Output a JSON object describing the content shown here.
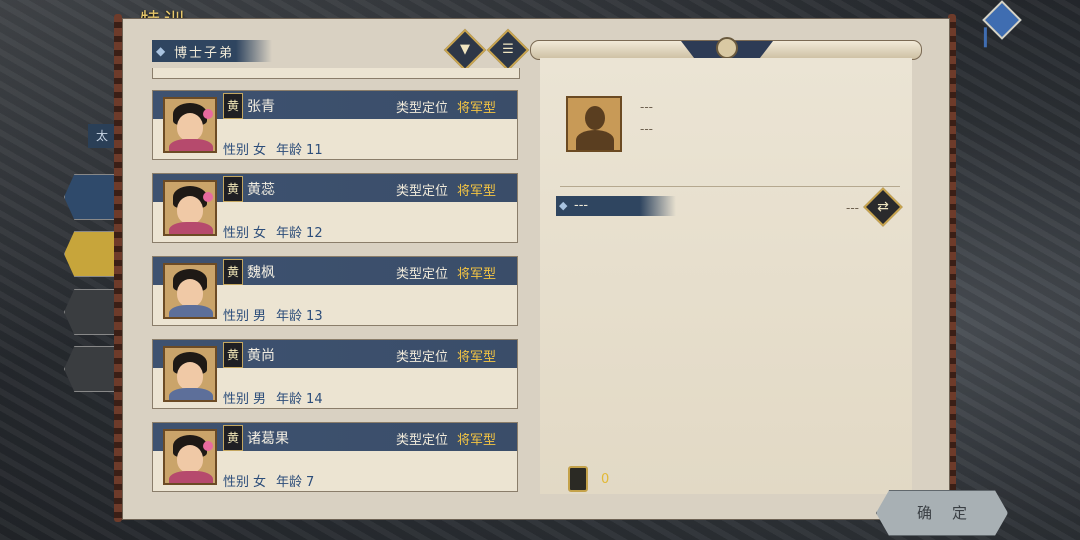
{
  "window": {
    "title": "特训",
    "side_label": "太"
  },
  "list": {
    "header": "博士子弟",
    "filter_icon": "filter-icon",
    "sort_icon": "list-icon",
    "type_label": "类型定位",
    "gender_label": "性别",
    "age_label": "年龄",
    "items": [
      {
        "badge": "黄",
        "name": "张青",
        "type": "将军型",
        "gender": "女",
        "age": "11",
        "sex": "female"
      },
      {
        "badge": "黄",
        "name": "黄蕊",
        "type": "将军型",
        "gender": "女",
        "age": "12",
        "sex": "female"
      },
      {
        "badge": "黄",
        "name": "魏枫",
        "type": "将军型",
        "gender": "男",
        "age": "13",
        "sex": "male"
      },
      {
        "badge": "黄",
        "name": "黄尚",
        "type": "将军型",
        "gender": "男",
        "age": "14",
        "sex": "male"
      },
      {
        "badge": "黄",
        "name": "诸葛果",
        "type": "将军型",
        "gender": "女",
        "age": "7",
        "sex": "female"
      }
    ]
  },
  "detail": {
    "line1": "---",
    "line2": "---",
    "tag": "---",
    "tag_value": "---",
    "token_value": "0"
  },
  "footer": {
    "confirm_label": "确定"
  },
  "colors": {
    "accent_gold": "#f3c443",
    "header_blue": "#3e5270",
    "info_blue": "#2c4d7a"
  }
}
